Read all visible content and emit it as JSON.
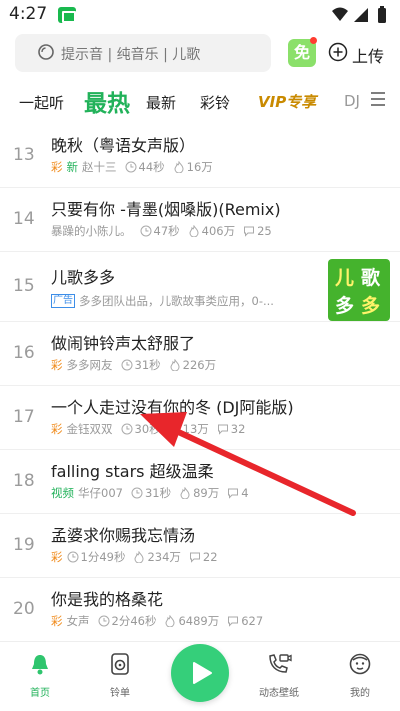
{
  "status_bar": {
    "time": "4:27"
  },
  "search": {
    "placeholder": "提示音 | 纯音乐 | 儿歌"
  },
  "header": {
    "free_label": "免",
    "upload_label": "上传"
  },
  "tabs": [
    {
      "label": "一起听",
      "active": false
    },
    {
      "label": "最热",
      "active": true
    },
    {
      "label": "最新",
      "active": false
    },
    {
      "label": "彩铃",
      "active": false
    },
    {
      "label": "VIP专享",
      "active": false
    },
    {
      "label": "DJ",
      "active": false
    }
  ],
  "songs": [
    {
      "rank": "13",
      "title": "晚秋（粤语女声版）",
      "tags": [
        "彩",
        "新"
      ],
      "author": "赵十三",
      "duration": "44秒",
      "plays": "16万",
      "comments": ""
    },
    {
      "rank": "14",
      "title": "只要有你 -青墨(烟嗓版)(Remix)",
      "tags": [],
      "author": "暴躁的小陈儿。",
      "duration": "47秒",
      "plays": "406万",
      "comments": "25"
    },
    {
      "rank": "15",
      "title": "儿歌多多",
      "ad_label": "广告",
      "ad_desc": "多多团队出品，儿歌故事类应用，0-...",
      "ad_image_text": [
        "儿",
        "歌",
        "多",
        "多"
      ]
    },
    {
      "rank": "16",
      "title": "做闹钟铃声太舒服了",
      "tags": [
        "彩"
      ],
      "author": "多多网友",
      "duration": "31秒",
      "plays": "226万",
      "comments": ""
    },
    {
      "rank": "17",
      "title": "一个人走过没有你的冬 (DJ阿能版)",
      "tags": [
        "彩"
      ],
      "author": "金钰双双",
      "duration": "30秒",
      "plays": "13万",
      "comments": "32"
    },
    {
      "rank": "18",
      "title": "falling stars 超级温柔",
      "tags": [
        "视频"
      ],
      "author": "华仔007",
      "duration": "31秒",
      "plays": "89万",
      "comments": "4"
    },
    {
      "rank": "19",
      "title": "孟婆求你赐我忘情汤",
      "tags": [
        "彩"
      ],
      "author": "",
      "duration": "1分49秒",
      "plays": "234万",
      "comments": "22"
    },
    {
      "rank": "20",
      "title": "你是我的格桑花",
      "tags": [
        "彩"
      ],
      "author": "女声",
      "duration": "2分46秒",
      "plays": "6489万",
      "comments": "627"
    }
  ],
  "bottom_nav": [
    {
      "label": "首页",
      "active": true
    },
    {
      "label": "铃单",
      "active": false
    },
    {
      "label": "动态壁纸",
      "active": false
    },
    {
      "label": "我的",
      "active": false
    }
  ],
  "colors": {
    "accent": "#22b25a",
    "cai_tag": "#f08c1e",
    "vip": "#c98a00",
    "annotation_arrow": "#e8262b",
    "play_button": "#35cf7a"
  }
}
